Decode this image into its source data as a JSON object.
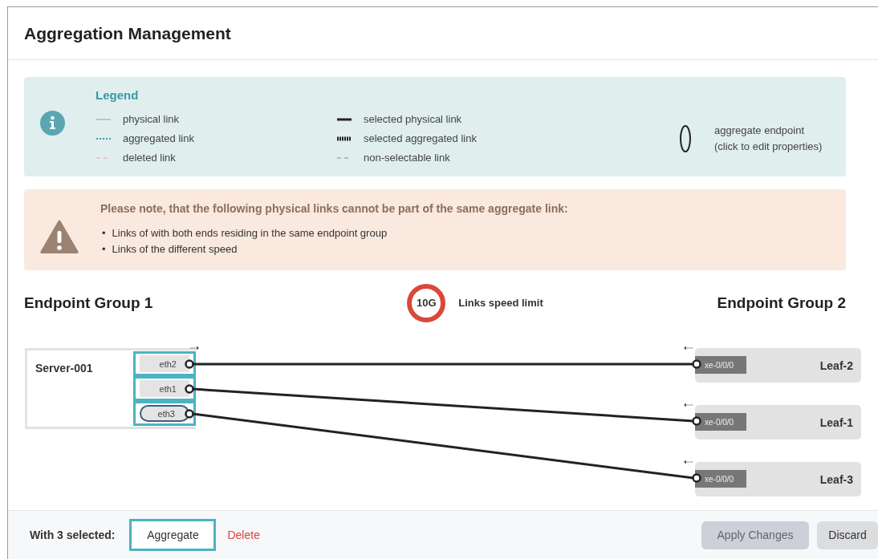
{
  "title": "Aggregation Management",
  "legend": {
    "title": "Legend",
    "items": [
      {
        "kind": "physical",
        "label": "physical link"
      },
      {
        "kind": "aggregated",
        "label": "aggregated link"
      },
      {
        "kind": "deleted",
        "label": "deleted link"
      },
      {
        "kind": "selected-physical",
        "label": "selected physical link"
      },
      {
        "kind": "selected-aggregated",
        "label": "selected aggregated link"
      },
      {
        "kind": "non-selectable",
        "label": "non-selectable link"
      },
      {
        "kind": "endpoint",
        "label": "aggregate endpoint (click to edit properties)"
      }
    ]
  },
  "notice": {
    "title": "Please note, that the following physical links cannot be part of the same aggregate link:",
    "bullet": "•",
    "items": [
      "Links of with both ends residing in the same endpoint group",
      "Links of the different speed"
    ]
  },
  "groups": {
    "left": "Endpoint Group 1",
    "right": "Endpoint Group 2",
    "speed": "10G",
    "speed_label": "Links speed limit"
  },
  "server": {
    "name": "Server-001",
    "ports": [
      {
        "label": "eth2",
        "selected": true,
        "aggregated": false
      },
      {
        "label": "eth1",
        "selected": true,
        "aggregated": false
      },
      {
        "label": "eth3",
        "selected": true,
        "aggregated": true
      }
    ]
  },
  "leaves": [
    {
      "name": "Leaf-2",
      "port": "xe-0/0/0"
    },
    {
      "name": "Leaf-1",
      "port": "xe-0/0/0"
    },
    {
      "name": "Leaf-3",
      "port": "xe-0/0/0"
    }
  ],
  "links": [
    {
      "selected": true
    },
    {
      "selected": true
    },
    {
      "selected": true
    }
  ],
  "footer": {
    "selection_label": "With 3 selected:",
    "buttons": [
      {
        "kind": "outline",
        "label": "Aggregate",
        "disabled": false
      },
      {
        "kind": "danger-link",
        "label": "Delete",
        "disabled": false
      },
      {
        "kind": "primary",
        "label": "Apply Changes",
        "disabled": true
      },
      {
        "kind": "secondary",
        "label": "Discard",
        "disabled": false
      }
    ]
  }
}
